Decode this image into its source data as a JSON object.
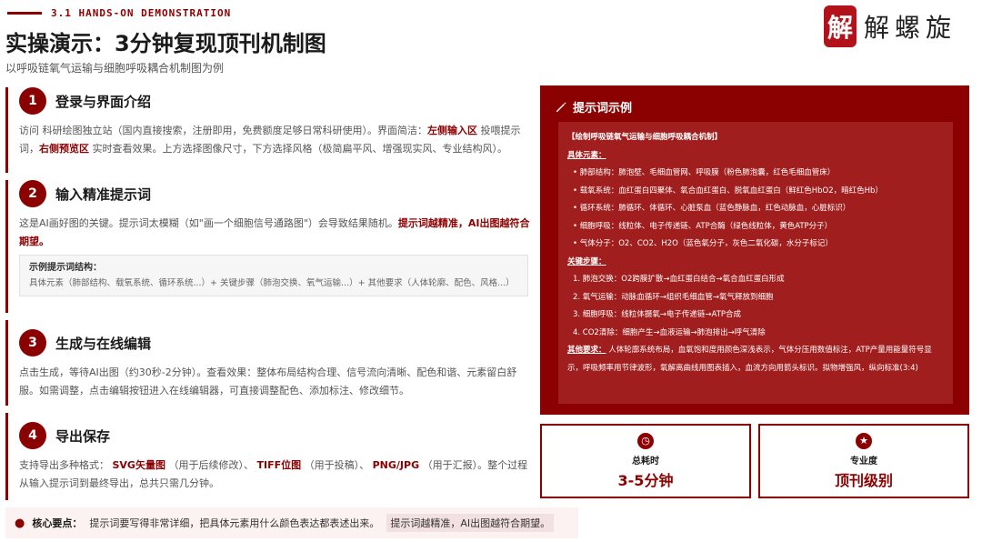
{
  "header": {
    "section_tag": "3.1 HANDS-ON DEMONSTRATION",
    "title": "实操演示：3分钟复现顶刊机制图",
    "subtitle": "以呼吸链氧气运输与细胞呼吸耦合机制图为例"
  },
  "logo": {
    "seal_char": "解",
    "text": "解螺旋"
  },
  "steps": [
    {
      "num": "1",
      "title": "登录与界面介绍",
      "body_a": "访问 科研绘图独立站（国内直接搜索，注册即用，免费额度足够日常科研使用）。界面简洁：",
      "hl_a": "左侧输入区",
      "body_b": "投喂提示词，",
      "hl_b": "右侧预览区",
      "body_c": "实时查看效果。上方选择图像尺寸，下方选择风格（极简扁平风、增强现实风、专业结构风）。"
    },
    {
      "num": "2",
      "title": "输入精准提示词",
      "body_a": "这是AI画好图的关键。提示词太模糊（如\"画一个细胞信号通路图\"）会导致结果随机。",
      "hl_a": "提示词越精准，AI出图越符合期望。",
      "example_title": "示例提示词结构：",
      "example_body": "具体元素（肺部结构、载氧系统、循环系统...）+ 关键步骤（肺泡交换、氧气运输...）+ 其他要求（人体轮廓、配色、风格...）"
    },
    {
      "num": "3",
      "title": "生成与在线编辑",
      "body_a": "点击生成，等待AI出图（约30秒-2分钟）。查看效果：整体布局结构合理、信号流向清晰、配色和谐、元素留白舒服。如需调整，点击编辑按钮进入在线编辑器，可直接调整配色、添加标注、修改细节。"
    },
    {
      "num": "4",
      "title": "导出保存",
      "body_a": "支持导出多种格式：",
      "hl_a": "SVG矢量图",
      "body_b": "（用于后续修改）、",
      "hl_b": "TIFF位图",
      "body_c": "（用于投稿）、",
      "hl_c": "PNG/JPG",
      "body_d": "（用于汇报）。整个过程从输入提示词到最终导出，总共只需几分钟。"
    }
  ],
  "core": {
    "label": "核心要点：",
    "text": "提示词要写得非常详细，把具体元素用什么颜色表达都表述出来。",
    "highlight": "提示词越精准，AI出图越符合期望。"
  },
  "prompt_panel": {
    "title": "提示词示例",
    "heading": "【绘制呼吸链氧气运输与细胞呼吸耦合机制】",
    "elements_title": "具体元素：",
    "elements": [
      "• 肺部结构：肺泡壁、毛细血管网、呼吸膜（粉色肺泡囊，红色毛细血管床）",
      "• 载氧系统：血红蛋白四聚体、氧合血红蛋白、脱氧血红蛋白（鲜红色HbO2，暗红色Hb）",
      "• 循环系统：肺循环、体循环、心脏泵血（蓝色静脉血，红色动脉血，心脏标识）",
      "• 细胞呼吸：线粒体、电子传递链、ATP合酶（绿色线粒体，黄色ATP分子）",
      "• 气体分子：O2、CO2、H2O（蓝色氧分子，灰色二氧化碳，水分子标记）"
    ],
    "steps_title": "关键步骤：",
    "steps": [
      "1.  肺泡交换：O2跨膜扩散→血红蛋白结合→氧合血红蛋白形成",
      "2.  氧气运输：动脉血循环→组织毛细血管→氧气释放到细胞",
      "3.  细胞呼吸：线粒体摄氧→电子传递链→ATP合成",
      "4.  CO2清除：细胞产生→血液运输→肺泡排出→呼气清除"
    ],
    "other_title": "其他要求：",
    "other_text": "人体轮廓系统布局，血氧饱和度用颜色深浅表示，气体分压用数值标注，ATP产量用能量符号显示，呼吸频率用节律波形，氧解离曲线用图表插入，血流方向用箭头标识。拟物增强风，纵向标准(3:4)"
  },
  "stats": [
    {
      "label": "总耗时",
      "value": "3-5分钟",
      "icon": "clock-icon"
    },
    {
      "label": "专业度",
      "value": "顶刊级别",
      "icon": "medal-icon"
    }
  ],
  "colors": {
    "accent": "#8b0000",
    "panel": "#8b0000",
    "panel_inner": "#a01e1e"
  }
}
